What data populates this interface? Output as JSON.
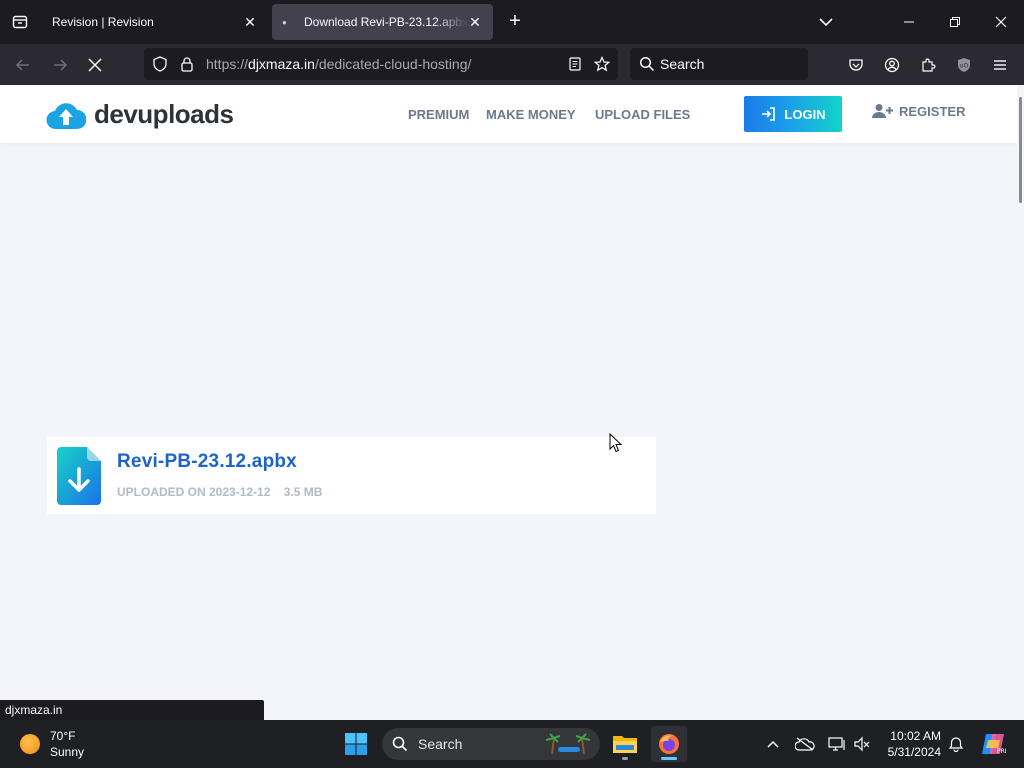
{
  "browser": {
    "tabs": [
      {
        "title": "Revision | Revision",
        "active": false
      },
      {
        "title": "Download Revi-PB-23.12.apbx | D",
        "active": true
      }
    ],
    "url": {
      "scheme": "https://",
      "domain": "djxmaza.in",
      "path": "/dedicated-cloud-hosting/"
    },
    "search_placeholder": "Search",
    "status_url": "djxmaza.in"
  },
  "site": {
    "logo_text": "devuploads",
    "nav": {
      "premium": "PREMIUM",
      "make_money": "MAKE MONEY",
      "upload_files": "UPLOAD FILES",
      "login": "LOGIN",
      "register": "REGISTER"
    },
    "accent_color": "#1b7be9",
    "file": {
      "name": "Revi-PB-23.12.apbx",
      "uploaded_label": "UPLOADED ON 2023-12-12",
      "size": "3.5 MB"
    }
  },
  "taskbar": {
    "weather": {
      "temp": "70°F",
      "condition": "Sunny"
    },
    "search_label": "Search",
    "clock": {
      "time": "10:02 AM",
      "date": "5/31/2024"
    }
  }
}
